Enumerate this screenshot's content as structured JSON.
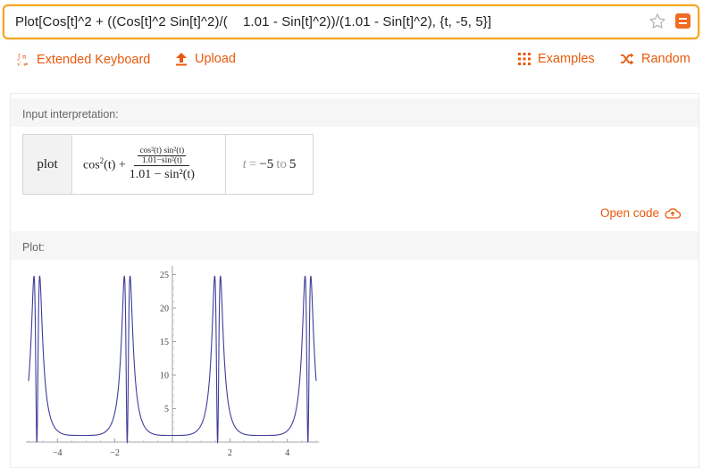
{
  "query": {
    "text": "Plot[Cos[t]^2 + ((Cos[t]^2 Sin[t]^2)/(    1.01 - Sin[t]^2))/(1.01 - Sin[t]^2), {t, -5, 5}]",
    "star_icon": "star-icon",
    "equals_icon": "equals-icon"
  },
  "toolbar": {
    "extended_keyboard": "Extended Keyboard",
    "upload": "Upload",
    "examples": "Examples",
    "random": "Random"
  },
  "input_pod": {
    "title": "Input interpretation:",
    "cell_plot": "plot",
    "formula": {
      "lead": "cos",
      "exp": "2",
      "arg": "(t) +",
      "inner_num": "cos²(t) sin²(t)",
      "inner_den": "1.01−sin²(t)",
      "outer_den": "1.01 − sin²(t)"
    },
    "range": {
      "var": "t",
      "eq": "=",
      "from": "−5",
      "to_word": "to",
      "to": "5"
    },
    "open_code": "Open code"
  },
  "plot_pod": {
    "title": "Plot:"
  },
  "chart_data": {
    "type": "line",
    "title": "",
    "xlabel": "",
    "ylabel": "",
    "xlim": [
      -5,
      5
    ],
    "ylim": [
      0,
      26
    ],
    "x_ticks": [
      -4,
      -2,
      2,
      4
    ],
    "x_tick_labels": [
      "−4",
      "−2",
      "2",
      "4"
    ],
    "y_ticks": [
      5,
      10,
      15,
      20,
      25
    ],
    "y_tick_labels": [
      "5",
      "10",
      "15",
      "20",
      "25"
    ],
    "series": [
      {
        "function": "cos(t)^2 + (cos(t)^2 sin(t)^2/(1.01 - sin(t)^2))/(1.01 - sin(t)^2)",
        "color": "#3f3d99"
      }
    ],
    "grid": false
  }
}
